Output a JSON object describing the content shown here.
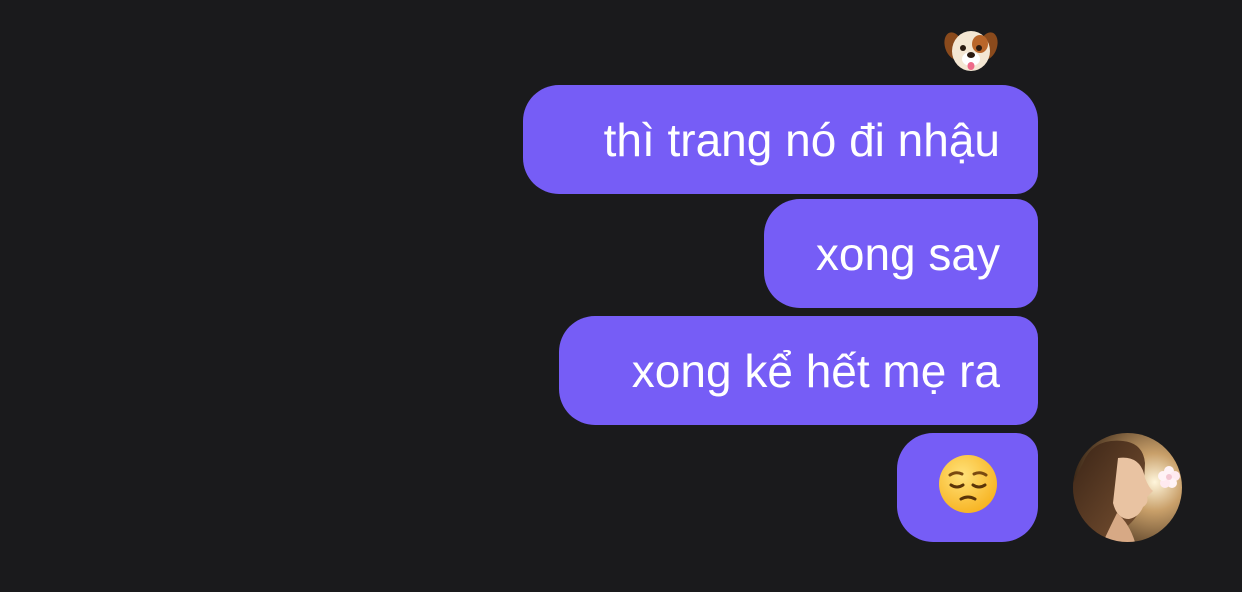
{
  "conversation": {
    "reaction": {
      "icon": "dog-face-icon"
    },
    "messages": [
      {
        "text": "thì trang nó đi nhậu"
      },
      {
        "text": "xong say"
      },
      {
        "text": "xong kể hết mẹ ra"
      },
      {
        "icon": "pensive-face-emoji-icon"
      }
    ],
    "avatar": {
      "icon": "user-avatar-photo"
    }
  },
  "colors": {
    "background": "#1a1a1c",
    "bubble": "#765df6",
    "text": "#ffffff"
  }
}
